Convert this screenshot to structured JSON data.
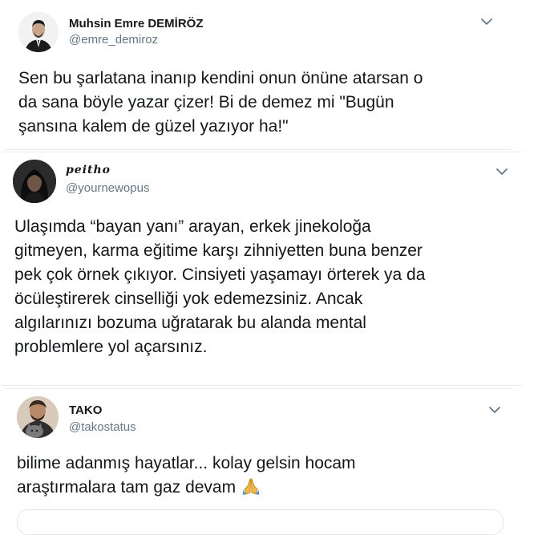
{
  "tweets": [
    {
      "name": "Muhsin Emre DEMİRÖZ",
      "handle": "@emre_demiroz",
      "avatar_icon": "avatar-man-suit",
      "lines": [
        "Sen bu şarlatana inanıp kendini onun önüne atarsan o",
        "da sana böyle yazar çizer! Bi de demez mi \"Bugün",
        "şansına kalem de güzel yazıyor ha!\""
      ]
    },
    {
      "name": "peitho",
      "handle": "@yournewopus",
      "avatar_icon": "avatar-woman-dark-hair",
      "lines": [
        "Ulaşımda “bayan yanı” arayan, erkek jinekoloğa",
        "gitmeyen, karma eğitime karşı zihniyetten buna benzer",
        "pek çok örnek çıkıyor. Cinsiyeti yaşamayı örterek ya da",
        "öcüleştirerek cinselliği yok edemezsiniz. Ancak",
        "algılarınızı bozuma uğratarak bu alanda mental",
        "problemlere yol açarsınız."
      ]
    },
    {
      "name": "TAKO",
      "handle": "@takostatus",
      "avatar_icon": "avatar-man-with-cat",
      "lines": [
        "bilime adanmış hayatlar... kolay gelsin hocam",
        "araştırmalara tam gaz devam"
      ],
      "emoji": "folded-hands-icon"
    }
  ],
  "colors": {
    "text": "#14171a",
    "handle": "#657786",
    "border": "#e6ecf0",
    "emoji": "#f2b84b"
  }
}
